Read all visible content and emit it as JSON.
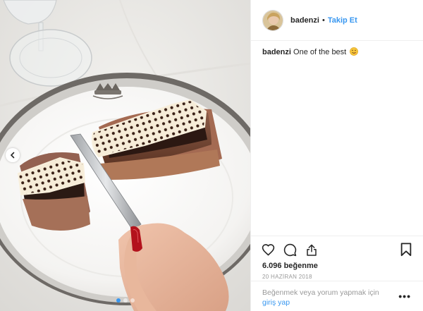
{
  "post": {
    "username": "badenzi",
    "separator": "•",
    "follow_label": "Takip Et",
    "caption": {
      "username": "badenzi",
      "text": "One of the best",
      "emoji": "savoring-food-emoji"
    },
    "likes": "6.096 beğenme",
    "date": "20 HAZİRAN 2018",
    "comment_prompt": "Beğenmek veya yorum yapmak için",
    "login_link": "giriş yap",
    "more_label": "•••",
    "carousel": {
      "count": 3,
      "active_index": 0
    },
    "icons": [
      "heart-icon",
      "comment-icon",
      "share-icon",
      "bookmark-icon",
      "chevron-left-icon"
    ],
    "colors": {
      "link": "#3897f0",
      "text": "#262626",
      "muted": "#999999",
      "border": "#efefef"
    }
  }
}
